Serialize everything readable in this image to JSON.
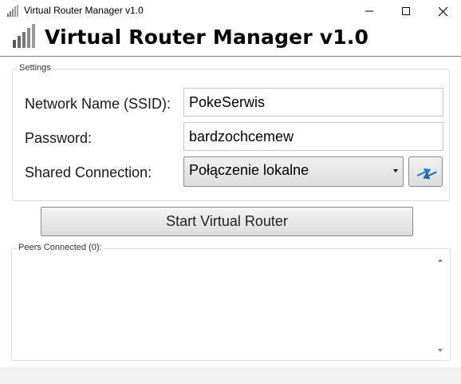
{
  "window": {
    "title": "Virtual Router Manager v1.0",
    "controls": {
      "minimize": "minimize-icon",
      "maximize": "maximize-icon",
      "close": "close-icon"
    }
  },
  "header": {
    "title": "Virtual Router Manager v1.0",
    "logo_icon": "signal-bars-icon"
  },
  "settings": {
    "legend": "Settings",
    "ssid_label": "Network Name (SSID):",
    "ssid_value": "PokeSerwis",
    "password_label": "Password:",
    "password_value": "bardzochcemew",
    "connection_label": "Shared Connection:",
    "connection_value": "Połączenie lokalne",
    "refresh_icon": "refresh-icon"
  },
  "actions": {
    "start_label": "Start Virtual Router"
  },
  "peers": {
    "legend": "Peers Connected (0):",
    "items": []
  },
  "colors": {
    "refresh_accent": "#2a78d4",
    "border": "#8c8c8c"
  }
}
